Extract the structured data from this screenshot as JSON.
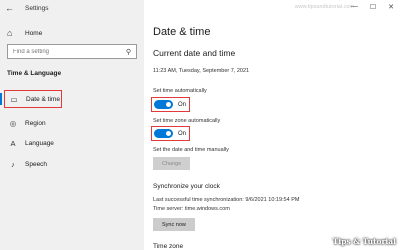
{
  "titlebar": {
    "app_title": "Settings"
  },
  "nav": {
    "home": "Home"
  },
  "search": {
    "placeholder": "Find a setting"
  },
  "sidebar": {
    "section_title": "Time & Language",
    "items": [
      {
        "label": "Date & time",
        "icon": "calendar-clock-icon"
      },
      {
        "label": "Region",
        "icon": "globe-icon"
      },
      {
        "label": "Language",
        "icon": "language-icon"
      },
      {
        "label": "Speech",
        "icon": "microphone-icon"
      }
    ]
  },
  "header": {
    "watermark": "www.tipsandtutorial.com"
  },
  "main": {
    "page_title": "Date & time",
    "sub_title": "Current date and time",
    "clock": "11:23 AM, Tuesday, September 7, 2021",
    "set_time_auto": {
      "label": "Set time automatically",
      "state": "On"
    },
    "set_tz_auto": {
      "label": "Set time zone automatically",
      "state": "On"
    },
    "manual": {
      "label": "Set the date and time manually",
      "button": "Change"
    },
    "sync": {
      "heading": "Synchronize your clock",
      "last_sync": "Last successful time synchronization: 9/6/2021 10:19:54 PM",
      "server": "Time server: time.windows.com",
      "button": "Sync now"
    },
    "time_zone_heading": "Time zone"
  },
  "watermark": "Tips & Tutorial",
  "colors": {
    "accent": "#0078d7",
    "highlight": "#e23a3a",
    "sidebar_bg": "#f0f0f0"
  }
}
